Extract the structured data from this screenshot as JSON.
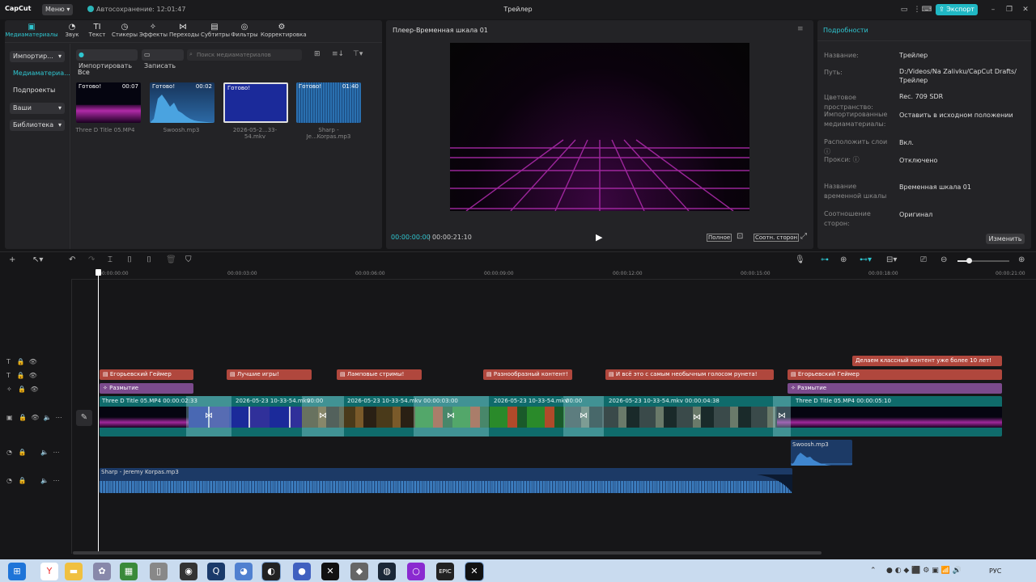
{
  "app": {
    "logo": "CapCut",
    "menu": "Меню",
    "autosave": "Автосохранение: 12:01:47",
    "title": "Трейлер",
    "export": "Экспорт"
  },
  "toolbar": [
    {
      "label": "Медиаматериалы",
      "icon": "media-icon",
      "active": true
    },
    {
      "label": "Звук",
      "icon": "audio-icon"
    },
    {
      "label": "Текст",
      "icon": "text-icon"
    },
    {
      "label": "Стикеры",
      "icon": "sticker-icon"
    },
    {
      "label": "Эффекты",
      "icon": "effects-icon"
    },
    {
      "label": "Переходы",
      "icon": "transitions-icon"
    },
    {
      "label": "Субтитры",
      "icon": "subtitles-icon"
    },
    {
      "label": "Фильтры",
      "icon": "filters-icon"
    },
    {
      "label": "Корректировка",
      "icon": "adjust-icon"
    }
  ],
  "media": {
    "side": {
      "import": "Импортир...",
      "media": "Медиаматериа...",
      "projects": "Подпроекты",
      "yours": "Ваши",
      "library": "Библиотека"
    },
    "import_btn": "Импортировать",
    "record_btn": "Записать",
    "search_placeholder": "Поиск медиаматериалов",
    "all": "Все",
    "items": [
      {
        "name": "Three D Title 05.MP4",
        "status": "Готово!",
        "dur": "00:07"
      },
      {
        "name": "Swoosh.mp3",
        "status": "Готово!",
        "dur": "00:02"
      },
      {
        "name": "2026-05-2...33-54.mkv",
        "status": "Готово!",
        "dur": ""
      },
      {
        "name": "Sharp - Je...Korpas.mp3",
        "status": "Готово!",
        "dur": "01:40"
      }
    ]
  },
  "player": {
    "title": "Плеер-Временная шкала 01",
    "current": "00:00:00:00",
    "total": "00:00:21:10",
    "full": "Полное",
    "ratio": "Соотн. сторон"
  },
  "details": {
    "title": "Подробности",
    "rows": [
      {
        "label": "Название:",
        "value": "Трейлер"
      },
      {
        "label": "Путь:",
        "value": "D:/Videos/Na Zalivku/CapCut Drafts/Трейлер"
      },
      {
        "label": "Цветовое пространство:",
        "value": "Rec. 709 SDR"
      },
      {
        "label": "Импортированные медиаматериалы:",
        "value": "Оставить в исходном положении"
      },
      {
        "label": "Расположить слои",
        "value": "Вкл."
      },
      {
        "label": "Прокси:",
        "value": "Отключено"
      },
      {
        "label": "Название временной шкалы",
        "value": "Временная шкала 01"
      },
      {
        "label": "Соотношение сторон:",
        "value": "Оригинал"
      }
    ],
    "change": "Изменить"
  },
  "ruler": [
    "00:00:00:00",
    "00:00:03:00",
    "00:00:06:00",
    "00:00:09:00",
    "00:00:12:00",
    "00:00:15:00",
    "00:00:18:00",
    "00:00:21:00"
  ],
  "tracks": {
    "text_top": [
      {
        "label": "Делаем классный контент уже более 10 лет!"
      }
    ],
    "text": [
      {
        "label": "Егорьевский Геймер"
      },
      {
        "label": "Лучшие игры!"
      },
      {
        "label": "Ламповые стримы!"
      },
      {
        "label": "Разнообразный контент!"
      },
      {
        "label": "И всё это с самым необычным голосом рунета!"
      },
      {
        "label": "Егорьевский Геймер"
      }
    ],
    "effects": [
      {
        "label": "Размытие"
      },
      {
        "label": "Размытие"
      }
    ],
    "video": [
      {
        "label": "Three D Title 05.MP4  00:00:02:33"
      },
      {
        "label": "2026-05-23 10-33-54.mkv"
      },
      {
        "label": "00:00"
      },
      {
        "label": "2026-05-23 10-33-54.mkv  00:00:03:00"
      },
      {
        "label": "2026-05-23 10-33-54.mkv"
      },
      {
        "label": "00:00"
      },
      {
        "label": "2026-05-23 10-33-54.mkv  00:00:04:38"
      },
      {
        "label": "Three D Title 05.MP4  00:00:05:10"
      }
    ],
    "sfx": "Swoosh.mp3",
    "music": "Sharp - Jeremy Korpas.mp3"
  },
  "taskbar": {
    "lang": "РУС"
  },
  "colors": {
    "accent": "#20b8c4",
    "text_clip": "#b0473d",
    "effect_clip": "#7b4a8c",
    "video_track": "#0f6b6b",
    "audio_clip": "#1c3a66"
  }
}
